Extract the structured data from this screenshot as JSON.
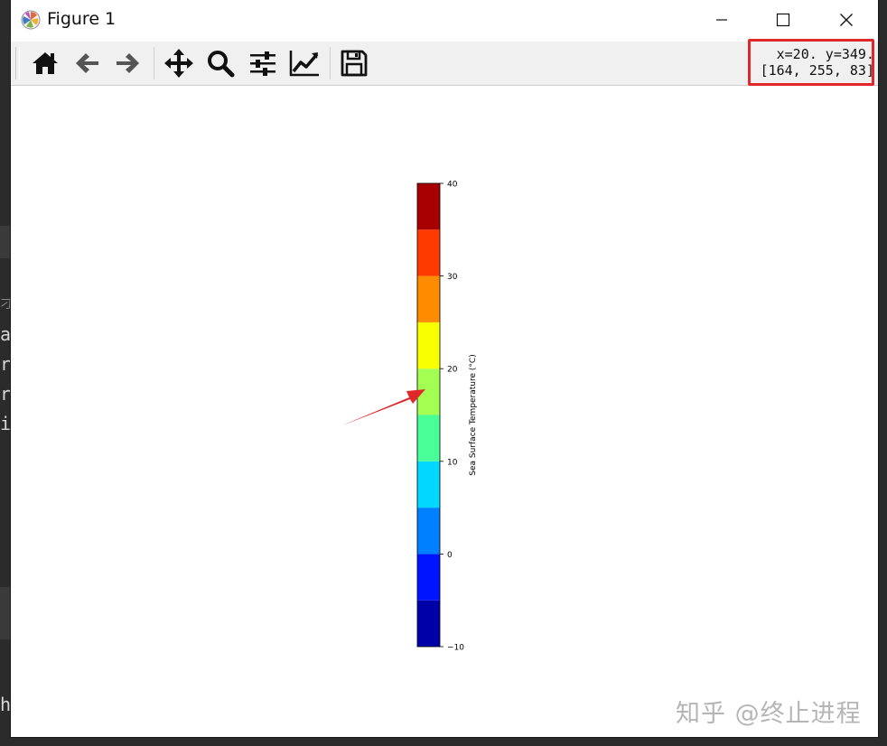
{
  "window": {
    "title": "Figure 1",
    "icons": {
      "app": "matplotlib-icon",
      "minimize": "minimize-icon",
      "maximize": "maximize-icon",
      "close": "close-icon"
    }
  },
  "toolbar": {
    "buttons": [
      {
        "name": "home",
        "icon": "home-icon"
      },
      {
        "name": "back",
        "icon": "arrow-left-icon"
      },
      {
        "name": "forward",
        "icon": "arrow-right-icon"
      },
      {
        "name": "pan",
        "icon": "move-icon"
      },
      {
        "name": "zoom",
        "icon": "magnifier-icon"
      },
      {
        "name": "configure-subplots",
        "icon": "sliders-icon"
      },
      {
        "name": "edit-axis",
        "icon": "line-chart-icon"
      },
      {
        "name": "save",
        "icon": "floppy-disk-icon"
      }
    ],
    "coords_line1": "x=20. y=349.",
    "coords_line2": "[164, 255, 83]"
  },
  "chart_data": {
    "type": "colorbar",
    "orientation": "vertical",
    "label": "Sea Surface Temperature (°C)",
    "vmin": -10,
    "vmax": 40,
    "boundaries": [
      -10,
      -5,
      0,
      5,
      10,
      15,
      20,
      25,
      30,
      35,
      40
    ],
    "colors": [
      "#0000a8",
      "#0014ff",
      "#0080ff",
      "#00d8ff",
      "#48ff98",
      "#a4ff53",
      "#f8ff00",
      "#ff8c00",
      "#ff3a00",
      "#a80000"
    ],
    "ticks": [
      -10,
      0,
      10,
      20,
      30,
      40
    ],
    "tick_labels": [
      "−10",
      "0",
      "10",
      "20",
      "30",
      "40"
    ]
  },
  "annotation": {
    "arrow_color": "#e0282b"
  },
  "watermark": "知乎 @终止进程",
  "background": {
    "code_fragments": [
      "刁",
      "a",
      "r",
      "r",
      "i",
      "ha"
    ]
  }
}
